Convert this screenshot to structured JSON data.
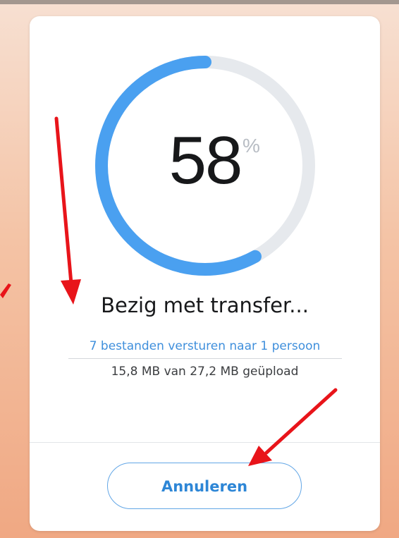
{
  "transfer": {
    "progress_percent": 58,
    "percent_value": "58",
    "percent_symbol": "%",
    "status_title": "Bezig met transfer...",
    "recipients_text": "7 bestanden versturen naar 1 persoon",
    "upload_status": "15,8 MB van 27,2 MB geüpload",
    "cancel_label": "Annuleren"
  },
  "colors": {
    "progress": "#4aa0f0",
    "track": "#e6e9ed",
    "link": "#3f8fdc",
    "button_text": "#2d86d6",
    "annotation_arrow": "#e8141a"
  },
  "annotations": [
    {
      "name": "red-arrow",
      "points_to": "status-title"
    },
    {
      "name": "red-arrow",
      "points_to": "cancel-button"
    },
    {
      "name": "red-arrow",
      "points_to": "off-card"
    }
  ]
}
